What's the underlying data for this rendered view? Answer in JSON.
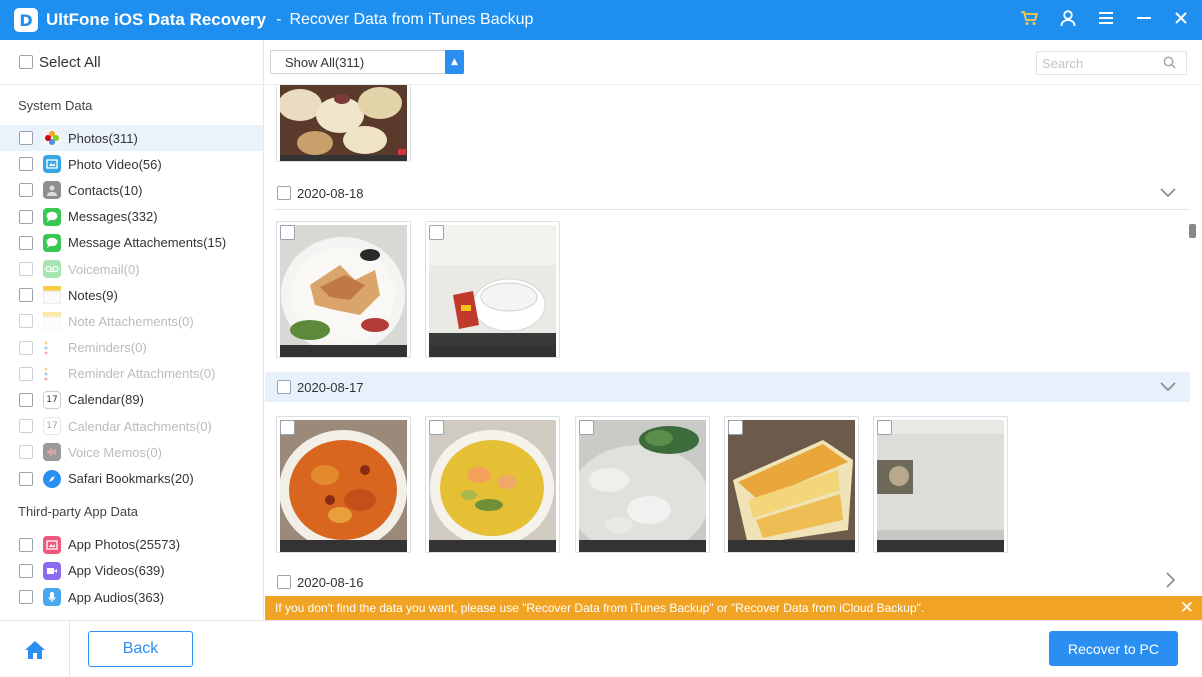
{
  "titlebar": {
    "logo_letter": "D",
    "app_name": "UltFone iOS Data Recovery",
    "separator": "-",
    "subtitle": "Recover Data from iTunes Backup",
    "icons": [
      "cart-icon",
      "user-icon",
      "menu-icon",
      "minimize-icon",
      "close-icon"
    ]
  },
  "sidebar": {
    "select_all": "Select All",
    "sections": [
      {
        "title": "System Data",
        "items": [
          {
            "label": "Photos(311)",
            "icon": "photos-icon",
            "color": "#f3f3f3",
            "disabled": false,
            "active": true
          },
          {
            "label": "Photo Video(56)",
            "icon": "photo-video-icon",
            "color": "#36a8e6",
            "disabled": false,
            "active": false
          },
          {
            "label": "Contacts(10)",
            "icon": "contacts-icon",
            "color": "#8f8f8f",
            "disabled": false,
            "active": false
          },
          {
            "label": "Messages(332)",
            "icon": "messages-icon",
            "color": "#3ac653",
            "disabled": false,
            "active": false
          },
          {
            "label": "Message Attachements(15)",
            "icon": "message-attachments-icon",
            "color": "#3ac653",
            "disabled": false,
            "active": false
          },
          {
            "label": "Voicemail(0)",
            "icon": "voicemail-icon",
            "color": "#3ac653",
            "disabled": true,
            "active": false
          },
          {
            "label": "Notes(9)",
            "icon": "notes-icon",
            "color": "#f7cf41",
            "disabled": false,
            "active": false
          },
          {
            "label": "Note Attachements(0)",
            "icon": "note-attachments-icon",
            "color": "#f7cf41",
            "disabled": true,
            "active": false
          },
          {
            "label": "Reminders(0)",
            "icon": "reminders-icon",
            "color": "#dddddd",
            "disabled": true,
            "active": false
          },
          {
            "label": "Reminder Attachments(0)",
            "icon": "reminder-attachments-icon",
            "color": "#dddddd",
            "disabled": true,
            "active": false
          },
          {
            "label": "Calendar(89)",
            "icon": "calendar-icon",
            "color": "#e84b3c",
            "disabled": false,
            "active": false
          },
          {
            "label": "Calendar Attachments(0)",
            "icon": "calendar-attachments-icon",
            "color": "#e84b3c",
            "disabled": true,
            "active": false
          },
          {
            "label": "Voice Memos(0)",
            "icon": "voice-memos-icon",
            "color": "#222222",
            "disabled": true,
            "active": false
          },
          {
            "label": "Safari Bookmarks(20)",
            "icon": "safari-icon",
            "color": "#2a8ff0",
            "disabled": false,
            "active": false
          }
        ]
      },
      {
        "title": "Third-party App Data",
        "items": [
          {
            "label": "App Photos(25573)",
            "icon": "app-photos-icon",
            "color": "#f0577a",
            "disabled": false,
            "active": false
          },
          {
            "label": "App Videos(639)",
            "icon": "app-videos-icon",
            "color": "#8b6cf0",
            "disabled": false,
            "active": false
          },
          {
            "label": "App Audios(363)",
            "icon": "app-audios-icon",
            "color": "#4aa8f0",
            "disabled": false,
            "active": false
          }
        ]
      }
    ]
  },
  "toolbar": {
    "filter_value": "Show All(311)",
    "search_placeholder": "Search"
  },
  "content": {
    "groups": [
      {
        "date": "2020-08-18",
        "chevron": "chevron-down-icon"
      },
      {
        "date": "2020-08-17",
        "chevron": "chevron-down-icon"
      },
      {
        "date": "2020-08-16",
        "chevron": "chevron-right-icon"
      }
    ]
  },
  "notice": {
    "text": "If you don't find the data you want, please use \"Recover Data from iTunes Backup\" or \"Recover Data from iCloud Backup\".",
    "accent": "#f1a424"
  },
  "bottombar": {
    "back_label": "Back",
    "recover_label": "Recover to PC",
    "accent": "#2a8ff0"
  }
}
